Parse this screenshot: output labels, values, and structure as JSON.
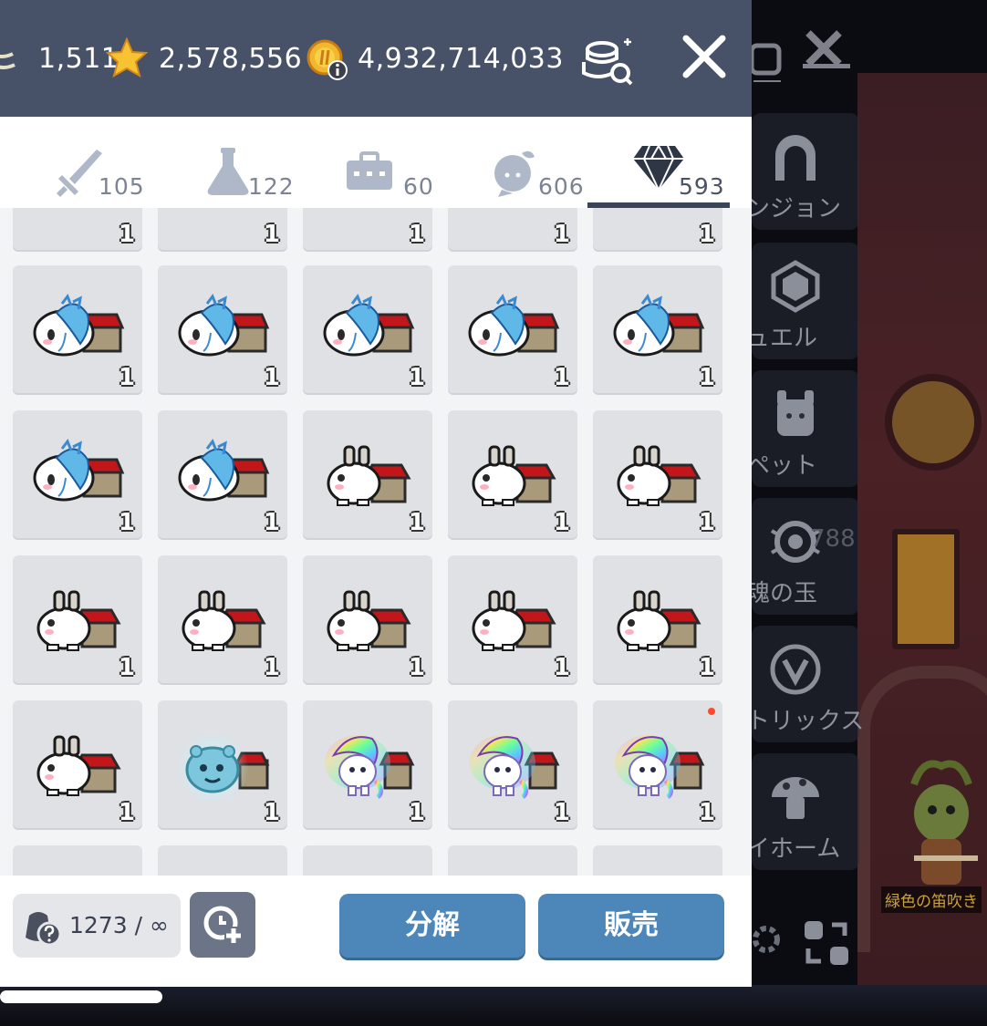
{
  "currencies": [
    {
      "icon": "crystal-currency-icon",
      "value": "1,511"
    },
    {
      "icon": "star-currency-icon",
      "value": "2,578,556"
    },
    {
      "icon": "meso-coin-icon",
      "value": "4,932,714,033"
    }
  ],
  "tabs": [
    {
      "icon": "sword-icon",
      "count": "105"
    },
    {
      "icon": "potion-flask-icon",
      "count": "122"
    },
    {
      "icon": "toolbox-icon",
      "count": "60"
    },
    {
      "icon": "cosmetic-head-icon",
      "count": "606"
    },
    {
      "icon": "diamond-icon",
      "count": "593",
      "active": true
    }
  ],
  "grid": {
    "partial_top_row_qty": [
      "1",
      "1",
      "1",
      "1",
      "1"
    ],
    "rows": [
      [
        {
          "item": "blue-fish-pet-house",
          "qty": "1"
        },
        {
          "item": "blue-fish-pet-house",
          "qty": "1"
        },
        {
          "item": "blue-fish-pet-house",
          "qty": "1"
        },
        {
          "item": "blue-fish-pet-house",
          "qty": "1"
        },
        {
          "item": "blue-fish-pet-house",
          "qty": "1"
        }
      ],
      [
        {
          "item": "blue-fish-pet-house",
          "qty": "1"
        },
        {
          "item": "blue-fish-pet-house",
          "qty": "1"
        },
        {
          "item": "white-rabbit-pet-house",
          "qty": "1"
        },
        {
          "item": "white-rabbit-pet-house",
          "qty": "1"
        },
        {
          "item": "white-rabbit-pet-house",
          "qty": "1"
        }
      ],
      [
        {
          "item": "white-rabbit-pet-house",
          "qty": "1"
        },
        {
          "item": "white-rabbit-pet-house",
          "qty": "1"
        },
        {
          "item": "white-rabbit-pet-house",
          "qty": "1"
        },
        {
          "item": "white-rabbit-pet-house",
          "qty": "1"
        },
        {
          "item": "white-rabbit-pet-house",
          "qty": "1"
        }
      ],
      [
        {
          "item": "white-rabbit-pet-house",
          "qty": "1"
        },
        {
          "item": "blue-slime-pet-house",
          "qty": "1"
        },
        {
          "item": "rainbow-unicorn-pet-house",
          "qty": "1"
        },
        {
          "item": "rainbow-unicorn-pet-house",
          "qty": "1"
        },
        {
          "item": "rainbow-unicorn-pet-house",
          "qty": "1",
          "new": true
        }
      ]
    ]
  },
  "footer": {
    "bag_count": "1273 / ∞",
    "disassemble_label": "分解",
    "sell_label": "販売"
  },
  "side_menu": {
    "items": [
      {
        "icon": "dungeon-gate-icon",
        "label": "ンジョン"
      },
      {
        "icon": "jewel-icon",
        "label": "ュエル"
      },
      {
        "icon": "pet-icon",
        "label": "ペット"
      },
      {
        "icon": "soul-orb-icon",
        "label": "魂の玉"
      },
      {
        "icon": "matrix-v-icon",
        "label": "トリックス"
      },
      {
        "icon": "mushroom-home-icon",
        "label": "イホーム"
      }
    ],
    "soul_count": "788",
    "npc_label": "緑色の笛吹き"
  },
  "colors": {
    "topbar": "#475168",
    "button": "#4d86b8",
    "tab_underline": "#3b4456",
    "cell": "#dfe1e5"
  }
}
